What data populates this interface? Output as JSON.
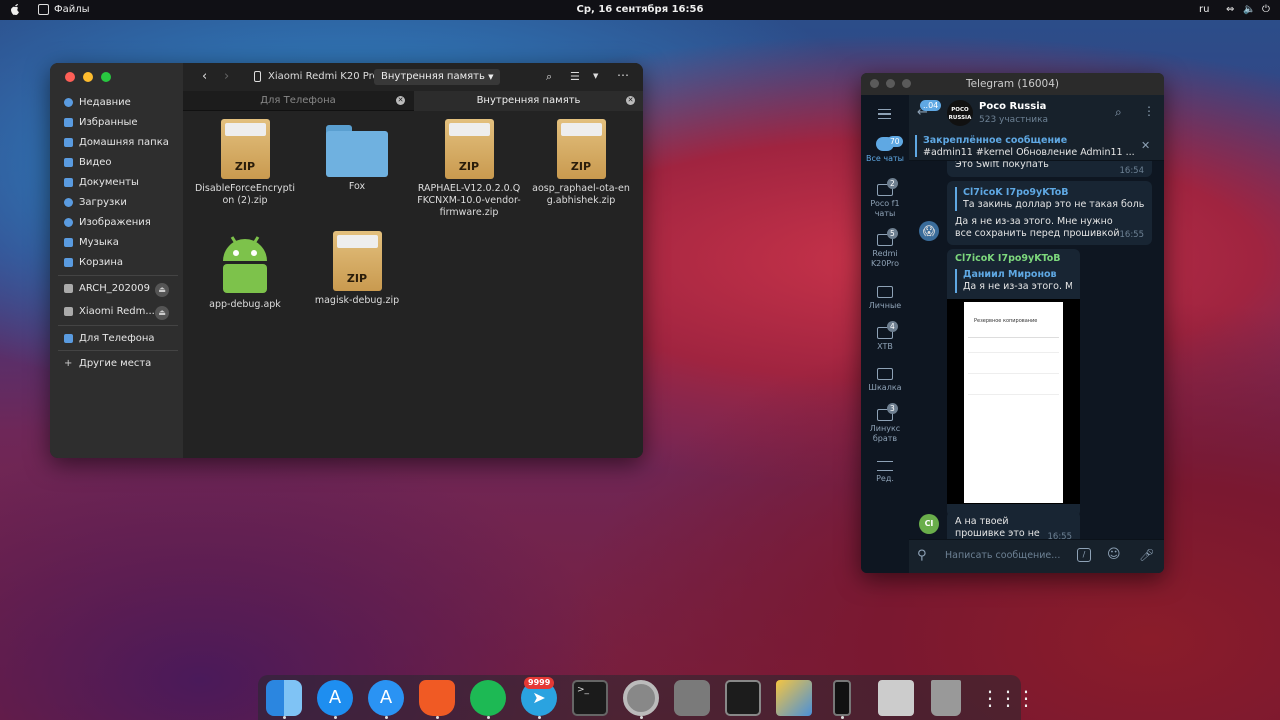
{
  "topbar": {
    "app_name": "Файлы",
    "clock": "Ср, 16 сентября  16:56",
    "lang": "ru"
  },
  "files": {
    "sidebar": [
      {
        "label": "Недавние",
        "icon": "clock-icon"
      },
      {
        "label": "Избранные",
        "icon": "star-icon"
      },
      {
        "label": "Домашняя папка",
        "icon": "home-icon"
      },
      {
        "label": "Видео",
        "icon": "video-icon"
      },
      {
        "label": "Документы",
        "icon": "document-icon"
      },
      {
        "label": "Загрузки",
        "icon": "download-icon"
      },
      {
        "label": "Изображения",
        "icon": "image-icon"
      },
      {
        "label": "Музыка",
        "icon": "music-icon"
      },
      {
        "label": "Корзина",
        "icon": "trash-icon"
      },
      {
        "label": "ARCH_202009",
        "icon": "drive-icon"
      },
      {
        "label": "Xiaomi Redm...",
        "icon": "phone-icon"
      },
      {
        "label": "Для Телефона",
        "icon": "folder-icon"
      },
      {
        "label": "Другие места",
        "icon": "plus-icon"
      }
    ],
    "location": "Xiaomi Redmi K20 Pro",
    "path_button": "Внутренняя память",
    "tabs": [
      "Для Телефона",
      "Внутренняя память"
    ],
    "items": [
      {
        "name": "DisableForceEncryption (2).zip",
        "type": "zip",
        "zip_label": "ZIP"
      },
      {
        "name": "Fox",
        "type": "folder"
      },
      {
        "name": "RAPHAEL-V12.0.2.0.QFKCNXM-10.0-vendor-firmware.zip",
        "type": "zip",
        "zip_label": "ZIP"
      },
      {
        "name": "aosp_raphael-ota-eng.abhishek.zip",
        "type": "zip",
        "zip_label": "ZIP"
      },
      {
        "name": "app-debug.apk",
        "type": "apk"
      },
      {
        "name": "magisk-debug.zip",
        "type": "zip",
        "zip_label": "ZIP"
      }
    ]
  },
  "telegram": {
    "title": "Telegram (16004)",
    "back_badge": "..04",
    "chat_name": "Poco Russia",
    "chat_sub": "523 участника",
    "avatar_text": "POCO RUSSIA",
    "folders": [
      {
        "label": "Все чаты",
        "badge": "70"
      },
      {
        "label": "Poco f1 чаты",
        "badge": "2"
      },
      {
        "label": "Redmi K20Pro",
        "badge": "5"
      },
      {
        "label": "Личные",
        "badge": ""
      },
      {
        "label": "XTB",
        "badge": "4"
      },
      {
        "label": "Шкалка",
        "badge": ""
      },
      {
        "label": "Линукс братв",
        "badge": "3"
      },
      {
        "label": "Ред.",
        "badge": ""
      }
    ],
    "pinned_title": "Закреплённое сообщение",
    "pinned_text": "#admin11 #kernel  Обновление Admin11 ...",
    "messages": {
      "m0_text": "Это Swift покупать",
      "m0_time": "16:54",
      "m1_reply_author": "Cl7icoK I7po9yKToB",
      "m1_reply_text": "Та закинь доллар это не такая больш...",
      "m1_text": "Да я не из-за этого. Мне нужно все сохранить перед прошивкой",
      "m1_time": "16:55",
      "m2_author": "Cl7icoK I7po9yKToB",
      "m2_reply_author": "Даниил Миронов",
      "m2_reply_text": "Да я не из-за этого. Мне нужно все ...",
      "m2_text": "А на твоей прошивке это не работает?",
      "m2_time": "16:55",
      "m2_avatar": "CI"
    },
    "screenshot_title": "Резервное копирование",
    "input_placeholder": "Написать сообщение..."
  },
  "dock": {
    "telegram_badge": "9999",
    "apps": [
      "finder-icon",
      "appstore-icon",
      "appstore2-icon",
      "brave-icon",
      "spotify-icon",
      "telegram-icon",
      "terminal-icon",
      "settings-icon",
      "system-prefs-icon",
      "monitor-icon",
      "photos-icon",
      "phone-icon",
      "disk-icon",
      "trash-icon",
      "launcher-icon"
    ]
  }
}
